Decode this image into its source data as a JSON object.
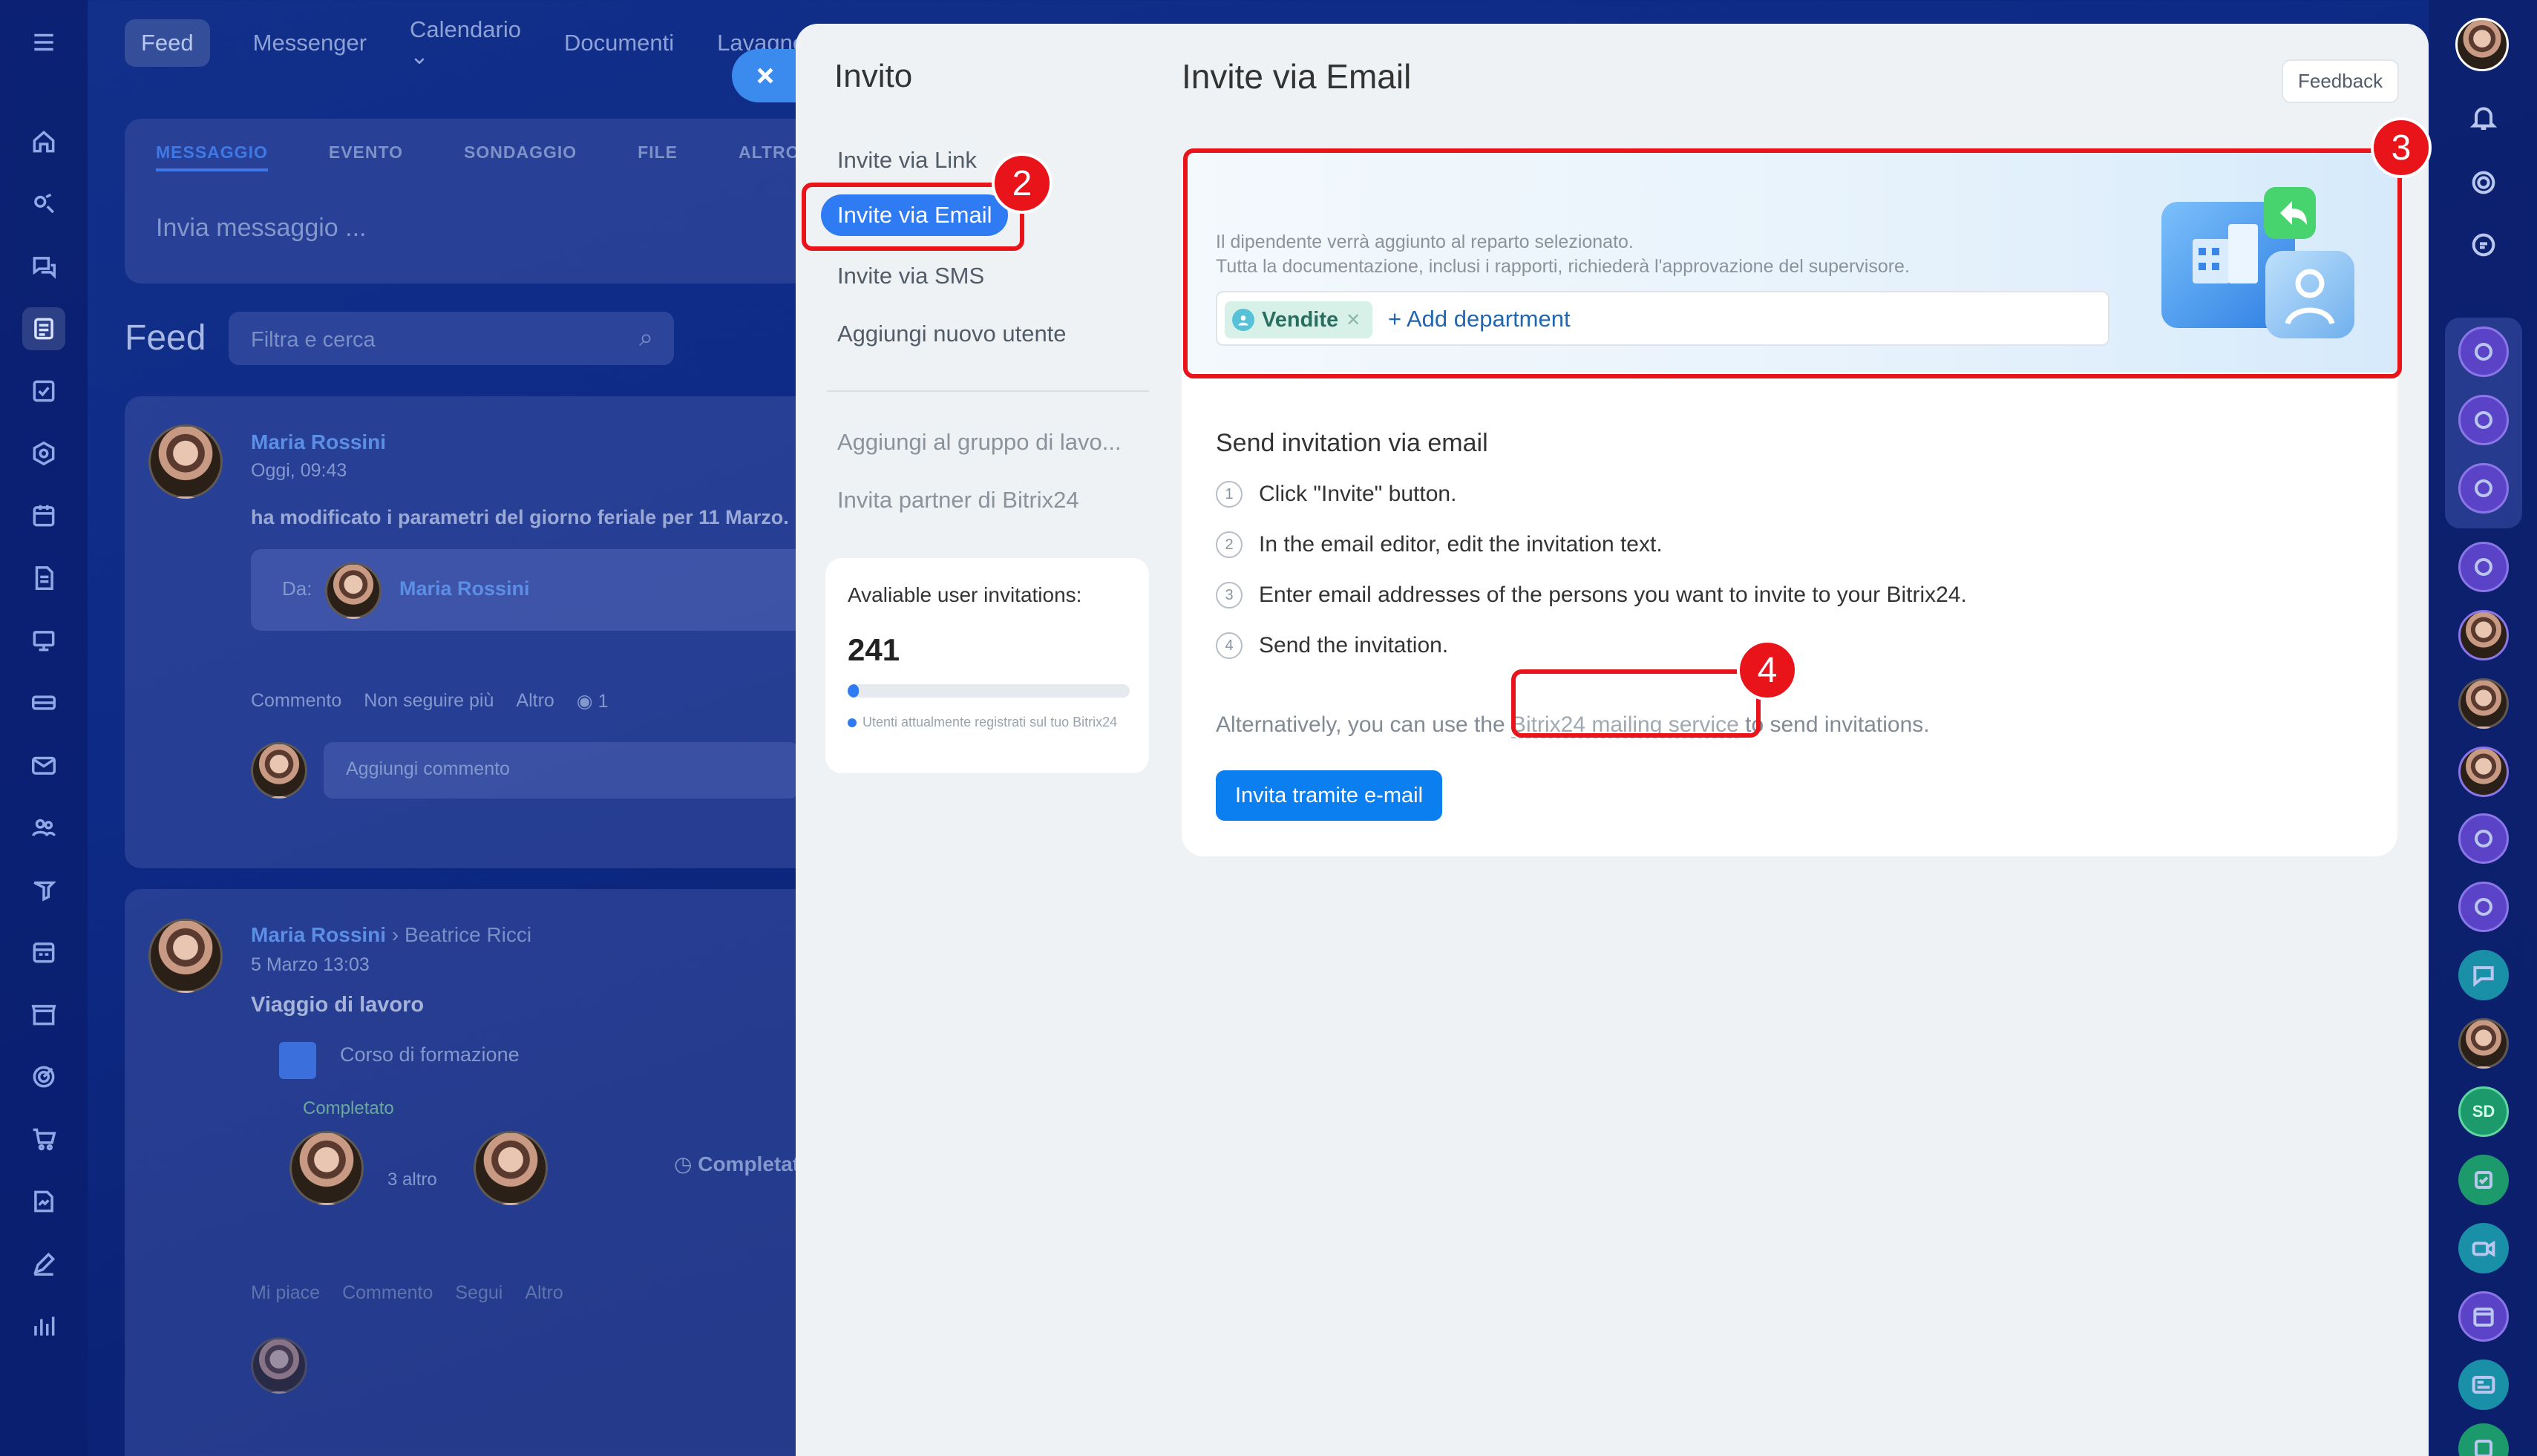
{
  "background_app": {
    "nav": [
      "Feed",
      "Messenger",
      "Calendario",
      "Documenti",
      "Lavagne"
    ],
    "composer_tabs": [
      "MESSAGGIO",
      "EVENTO",
      "SONDAGGIO",
      "FILE",
      "ALTRO"
    ],
    "composer_placeholder": "Invia messaggio ...",
    "feed_title": "Feed",
    "feed_search_placeholder": "Filtra e cerca",
    "post1": {
      "author": "Maria Rossini",
      "time": "Oggi, 09:43",
      "text": "ha modificato i parametri del giorno feriale per 11 Marzo.",
      "from_label": "Da:",
      "from_name": "Maria Rossini",
      "actions": [
        "Commento",
        "Non seguire più",
        "Altro"
      ],
      "views": "1",
      "comment_placeholder": "Aggiungi commento"
    },
    "post2": {
      "author": "Maria Rossini",
      "recipient": "Beatrice Ricci",
      "time": "5 Marzo 13:03",
      "title": "Viaggio di lavoro",
      "course": "Corso di formazione",
      "status": "Completato",
      "more": "3 altro",
      "status_right": "Completato",
      "actions": [
        "Mi piace",
        "Commento",
        "Segui",
        "Altro"
      ]
    }
  },
  "panel": {
    "sidebar_title": "Invito",
    "nav": [
      {
        "label": "Invite via Link",
        "active": false
      },
      {
        "label": "Invite via Email",
        "active": true
      },
      {
        "label": "Invite via SMS",
        "active": false
      },
      {
        "label": "Aggiungi nuovo utente",
        "active": false
      }
    ],
    "secondary_nav": [
      "Aggiungi al gruppo di lavo...",
      "Invita partner di Bitrix24"
    ],
    "invitations": {
      "label": "Avaliable user invitations:",
      "count": "241",
      "progress_percent": 4,
      "note": "Utenti attualmente registrati sul tuo Bitrix24"
    },
    "title": "Invite via Email",
    "feedback": "Feedback",
    "department": {
      "desc_line1": "Il dipendente verrà aggiunto al reparto selezionato.",
      "desc_line2": "Tutta la documentazione, inclusi i rapporti, richiederà l'approvazione del supervisore.",
      "tag": "Vendite",
      "add": "+ Add department"
    },
    "section_title": "Send invitation via email",
    "steps": [
      {
        "num": "1",
        "text": "Click \"Invite\" button."
      },
      {
        "num": "2",
        "text": "In the email editor, edit the invitation text."
      },
      {
        "num": "3",
        "text": "Enter email addresses of the persons you want to invite to your Bitrix24."
      },
      {
        "num": "4",
        "text": "Send the invitation."
      }
    ],
    "alt": {
      "before": "Alternatively, you can use the ",
      "link": "Bitrix24 mailing service",
      "after": " to send invitations."
    },
    "cta": "Invita tramite e-mail"
  },
  "annotations": [
    "2",
    "3",
    "4"
  ],
  "right_rail": {
    "sd": "SD"
  },
  "colors": {
    "accent": "#2f7bf3",
    "annotation": "#e8141a",
    "cta": "#0b7ef0"
  }
}
